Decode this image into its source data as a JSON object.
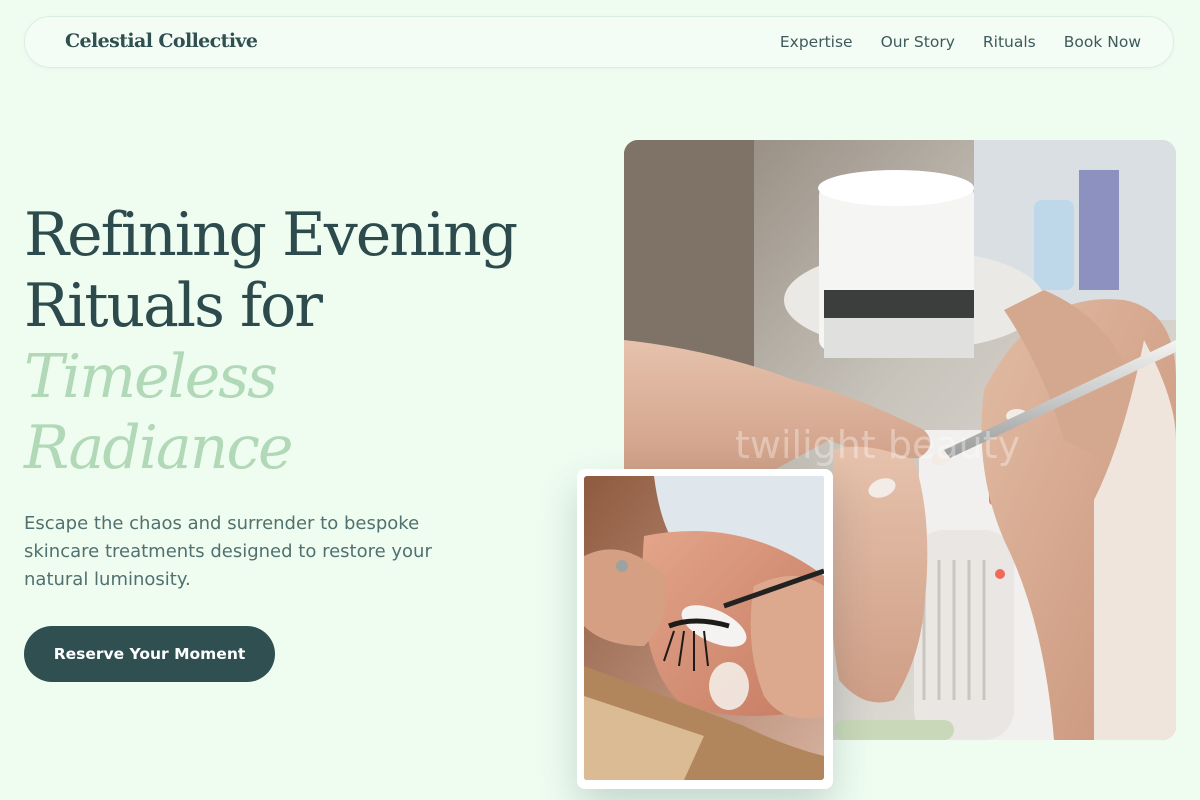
{
  "nav": {
    "brand": "Celestial Collective",
    "links": [
      "Expertise",
      "Our Story",
      "Rituals",
      "Book Now"
    ]
  },
  "hero": {
    "headline_line1": "Refining Evening",
    "headline_line2": "Rituals for",
    "headline_accent_line1": "Timeless",
    "headline_accent_line2": "Radiance",
    "description": "Escape the chaos and surrender to bespoke skincare treatments designed to restore your natural luminosity.",
    "cta_label": "Reserve Your Moment"
  },
  "images": {
    "main_watermark": "twilight beauty"
  },
  "colors": {
    "background": "#effdf1",
    "primary": "#2f4f51",
    "accent": "#b1d8b7"
  }
}
